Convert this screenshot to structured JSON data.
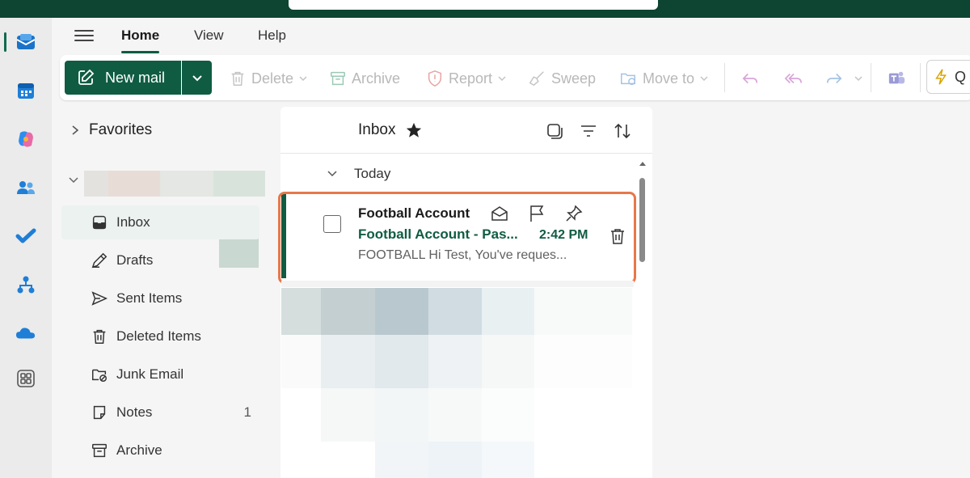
{
  "tabs": [
    {
      "label": "Home",
      "active": true
    },
    {
      "label": "View",
      "active": false
    },
    {
      "label": "Help",
      "active": false
    }
  ],
  "ribbon": {
    "new_mail": "New mail",
    "delete": "Delete",
    "archive": "Archive",
    "report": "Report",
    "sweep": "Sweep",
    "move_to": "Move to",
    "quick_steps": "Q"
  },
  "rail": {
    "apps": [
      "mail-icon",
      "calendar-icon",
      "copilot-icon",
      "people-icon",
      "todo-icon",
      "org-icon",
      "onedrive-icon",
      "apps-icon"
    ]
  },
  "folders": {
    "favorites": "Favorites",
    "items": [
      {
        "label": "Inbox",
        "icon": "inbox-icon",
        "count": "",
        "selected": true
      },
      {
        "label": "Drafts",
        "icon": "drafts-icon",
        "count": "",
        "selected": false
      },
      {
        "label": "Sent Items",
        "icon": "sent-icon",
        "count": "",
        "selected": false
      },
      {
        "label": "Deleted Items",
        "icon": "trash-icon",
        "count": "",
        "selected": false
      },
      {
        "label": "Junk Email",
        "icon": "junk-icon",
        "count": "",
        "selected": false
      },
      {
        "label": "Notes",
        "icon": "notes-icon",
        "count": "1",
        "selected": false
      },
      {
        "label": "Archive",
        "icon": "archive-icon",
        "count": "",
        "selected": false
      }
    ]
  },
  "list": {
    "title": "Inbox",
    "group": "Today",
    "message": {
      "sender": "Football Account",
      "subject": "Football Account - Pas...",
      "time": "2:42 PM",
      "preview": "FOOTBALL Hi Test, You've reques..."
    }
  },
  "colors": {
    "brand": "#0f5c43",
    "highlight": "#e8774a",
    "topbar": "#0e4432"
  }
}
